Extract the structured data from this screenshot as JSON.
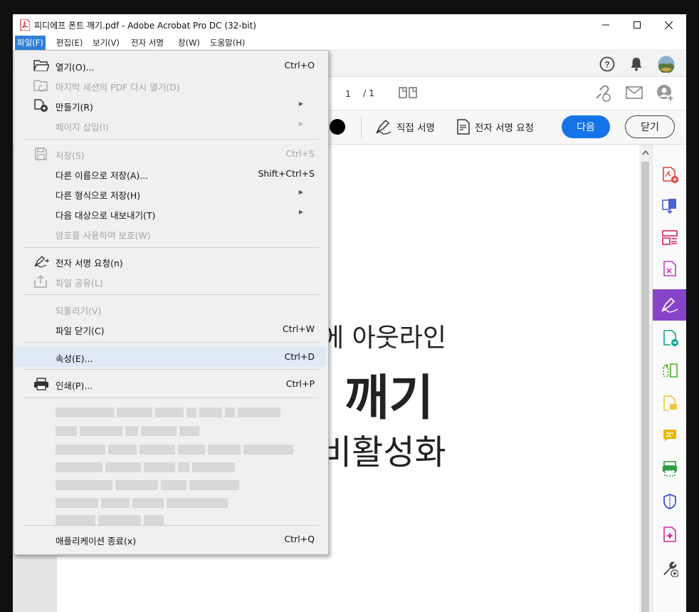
{
  "window": {
    "title": "피디에프 폰트 깨기.pdf - Adobe Acrobat Pro DC (32-bit)",
    "minimize_icon": "minimize-icon",
    "maximize_icon": "maximize-icon",
    "close_icon": "close-icon"
  },
  "menubar": [
    {
      "label": "파일(F)",
      "active": true
    },
    {
      "label": "편집(E)"
    },
    {
      "label": "보기(V)"
    },
    {
      "label": "전자 서명"
    },
    {
      "label": "창(W)"
    },
    {
      "label": "도움말(H)"
    }
  ],
  "header": {
    "help_icon": "help-icon",
    "bell_icon": "bell-icon",
    "avatar_icon": "avatar-icon"
  },
  "toolbar": {
    "page_current": "1",
    "page_total": "/ 1",
    "direct_sign_label": "직접 서명",
    "request_sign_label": "전자 서명 요청",
    "next_label": "다음",
    "close_label": "닫기"
  },
  "document": {
    "line1": "에 아웃라인",
    "line2": "깨기",
    "line3": "비활성화"
  },
  "file_menu": {
    "items": [
      {
        "label": "열기(O)...",
        "shortcut": "Ctrl+O",
        "icon": "open-folder-icon",
        "enabled": true
      },
      {
        "label": "마지막 세션의 PDF 다시 열기(D)",
        "icon": "reopen-icon",
        "enabled": false
      },
      {
        "label": "만들기(R)",
        "icon": "create-icon",
        "submenu": true,
        "enabled": true
      },
      {
        "label": "페이지 삽입(I)",
        "submenu": true,
        "enabled": false
      },
      {
        "label": "저장(S)",
        "shortcut": "Ctrl+S",
        "icon": "save-icon",
        "enabled": false
      },
      {
        "label": "다른 이름으로 저장(A)...",
        "shortcut": "Shift+Ctrl+S",
        "enabled": true
      },
      {
        "label": "다른 형식으로 저장(H)",
        "submenu": true,
        "enabled": true
      },
      {
        "label": "다음 대상으로 내보내기(T)",
        "submenu": true,
        "enabled": true
      },
      {
        "label": "암호를 사용하여 보호(W)",
        "enabled": false
      },
      {
        "label": "전자 서명 요청(n)",
        "icon": "sign-request-icon",
        "enabled": true
      },
      {
        "label": "파일 공유(L)",
        "icon": "share-icon",
        "enabled": false
      },
      {
        "label": "되돌리기(V)",
        "enabled": false
      },
      {
        "label": "파일 닫기(C)",
        "shortcut": "Ctrl+W",
        "enabled": true
      },
      {
        "label": "속성(E)...",
        "shortcut": "Ctrl+D",
        "enabled": true,
        "hover": true
      },
      {
        "label": "인쇄(P)...",
        "shortcut": "Ctrl+P",
        "icon": "print-icon",
        "enabled": true
      },
      {
        "label": "애플리케이션 종료(x)",
        "shortcut": "Ctrl+Q",
        "enabled": true
      }
    ]
  },
  "right_panel": [
    "create-pdf-icon",
    "combine-files-icon",
    "organize-pages-icon",
    "export-pdf-icon",
    "fill-sign-icon",
    "send-for-signature-icon",
    "compress-icon",
    "comment-icon",
    "sticky-note-icon",
    "scan-icon",
    "protect-icon",
    "edit-pdf-icon",
    "more-tools-icon"
  ],
  "colors": {
    "accent_blue": "#1473e6",
    "selected_tool_purple": "#8844c9",
    "menu_active": "#2f7fd6",
    "menu_hover": "#dfe9f5"
  }
}
